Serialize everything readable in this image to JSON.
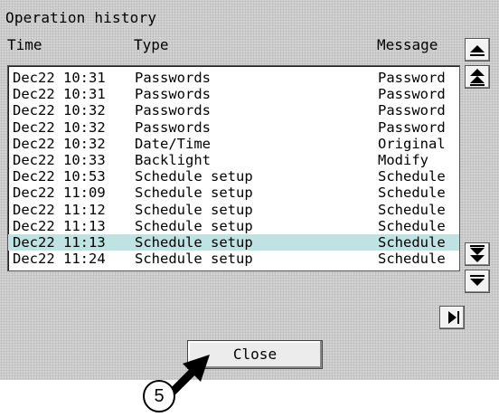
{
  "window": {
    "title": "Operation history"
  },
  "columns": {
    "time": "Time",
    "type": "Type",
    "message": "Message"
  },
  "rows": [
    {
      "time": "Dec22 10:31",
      "type": "Passwords",
      "message": "Password"
    },
    {
      "time": "Dec22 10:31",
      "type": "Passwords",
      "message": "Password"
    },
    {
      "time": "Dec22 10:32",
      "type": "Passwords",
      "message": "Password"
    },
    {
      "time": "Dec22 10:32",
      "type": "Passwords",
      "message": "Password"
    },
    {
      "time": "Dec22 10:32",
      "type": "Date/Time",
      "message": "Original"
    },
    {
      "time": "Dec22 10:33",
      "type": "Backlight",
      "message": "Modify"
    },
    {
      "time": "Dec22 10:53",
      "type": "Schedule setup",
      "message": "Schedule"
    },
    {
      "time": "Dec22 11:09",
      "type": "Schedule setup",
      "message": "Schedule"
    },
    {
      "time": "Dec22 11:12",
      "type": "Schedule setup",
      "message": "Schedule"
    },
    {
      "time": "Dec22 11:13",
      "type": "Schedule setup",
      "message": "Schedule"
    },
    {
      "time": "Dec22 11:13",
      "type": "Schedule setup",
      "message": "Schedule"
    },
    {
      "time": "Dec22 11:24",
      "type": "Schedule setup",
      "message": "Schedule"
    }
  ],
  "selected_row_index": 10,
  "buttons": {
    "close_label": "Close"
  },
  "callout": {
    "number": "5"
  },
  "icons": {
    "scroll_up": "arrow-up-icon",
    "scroll_top": "double-arrow-up-icon",
    "scroll_bottom": "double-arrow-down-icon",
    "scroll_down": "arrow-down-icon",
    "scroll_right": "arrow-right-icon"
  },
  "colors": {
    "selection": "#bfe3e3",
    "panel": "#d8d8d8",
    "list_bg": "#ffffff"
  }
}
